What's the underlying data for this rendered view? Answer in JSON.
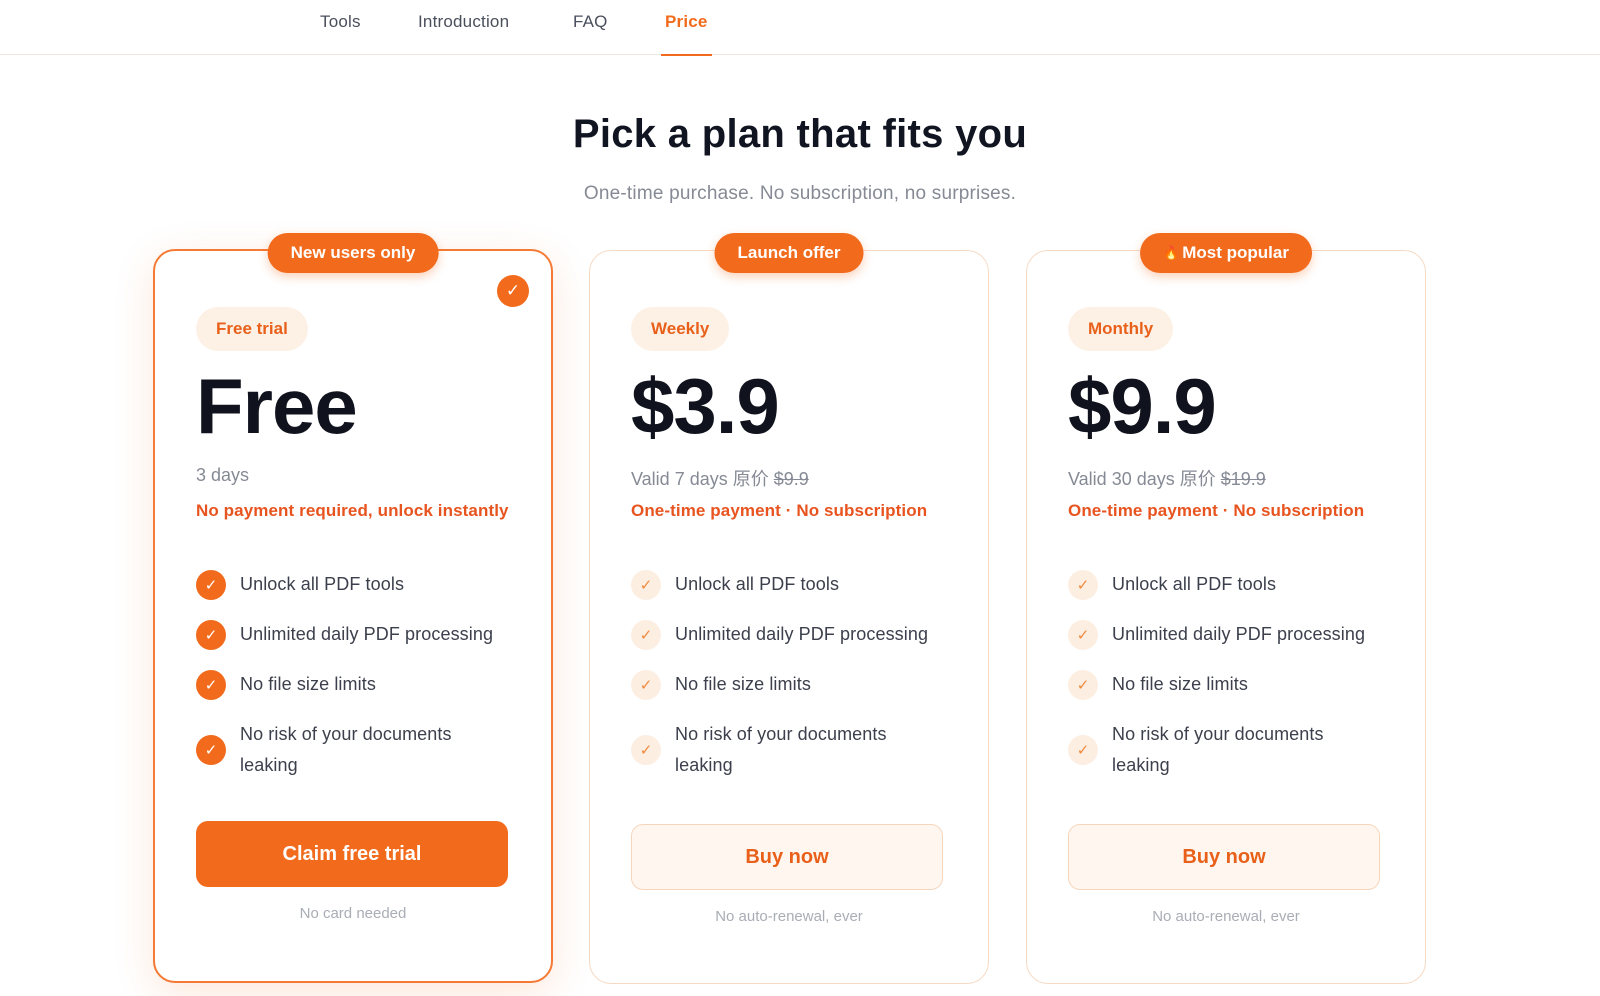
{
  "nav": {
    "items": [
      {
        "label": "Tools",
        "active": false
      },
      {
        "label": "Introduction",
        "active": false
      },
      {
        "label": "FAQ",
        "active": false
      },
      {
        "label": "Price",
        "active": true
      }
    ]
  },
  "hero": {
    "title": "Pick a plan that fits you",
    "subtitle": "One-time purchase. No subscription, no surprises."
  },
  "plans": [
    {
      "ribbon": "New users only",
      "selected": true,
      "tag": "Free trial",
      "price": "Free",
      "validity": "3 days",
      "validity_orig": "",
      "note": "No payment required, unlock instantly",
      "features": [
        "Unlock all PDF tools",
        "Unlimited daily PDF processing",
        "No file size limits",
        "No risk of your documents leaking"
      ],
      "cta": "Claim free trial",
      "footnote": "No card needed"
    },
    {
      "ribbon": "Launch offer",
      "selected": false,
      "tag": "Weekly",
      "price": "$3.9",
      "validity": "Valid 7 days 原价",
      "validity_orig": "$9.9",
      "note": "One-time payment · No subscription",
      "features": [
        "Unlock all PDF tools",
        "Unlimited daily PDF processing",
        "No file size limits",
        "No risk of your documents leaking"
      ],
      "cta": "Buy now",
      "footnote": "No auto-renewal, ever"
    },
    {
      "ribbon": "Most popular",
      "ribbon_icon": "fire-icon",
      "selected": false,
      "tag": "Monthly",
      "price": "$9.9",
      "validity": "Valid 30 days 原价",
      "validity_orig": "$19.9",
      "note": "One-time payment · No subscription",
      "features": [
        "Unlock all PDF tools",
        "Unlimited daily PDF processing",
        "No file size limits",
        "No risk of your documents leaking"
      ],
      "cta": "Buy now",
      "footnote": "No auto-renewal, ever"
    }
  ],
  "colors": {
    "accent": "#f26b1d",
    "title": "#111522",
    "muted": "#858a94",
    "note": "#e8541f"
  }
}
